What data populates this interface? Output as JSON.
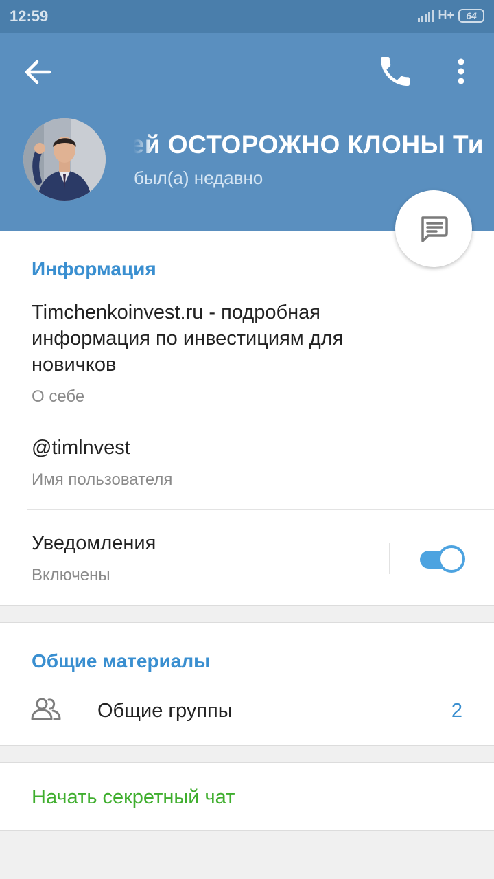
{
  "status_bar": {
    "time": "12:59",
    "network": "H+",
    "battery": "64"
  },
  "header": {
    "name": "ей ОСТОРОЖНО КЛОНЫ Ти",
    "last_seen": "был(а) недавно",
    "icons": {
      "back": "arrow-back-icon",
      "call": "phone-icon",
      "more": "more-vertical-icon",
      "message": "message-icon"
    }
  },
  "info": {
    "section_title": "Информация",
    "bio_lines": [
      "Timchenkoinvest.ru - подробная",
      "информация по инвестициям для",
      "новичков"
    ],
    "bio_label": "О себе",
    "username": "@timlnvest",
    "username_label": "Имя пользователя",
    "notifications_title": "Уведомления",
    "notifications_status": "Включены",
    "notifications_enabled": true
  },
  "shared": {
    "section_title": "Общие материалы",
    "groups_label": "Общие группы",
    "groups_count": "2",
    "groups_icon": "people-icon"
  },
  "secret_chat": {
    "label": "Начать секретный чат"
  },
  "colors": {
    "status_bar": "#4a7eab",
    "header": "#5a8fbf",
    "accent_blue": "#3a8fd0",
    "toggle": "#4da3e0",
    "secret_green": "#3fae2e"
  }
}
